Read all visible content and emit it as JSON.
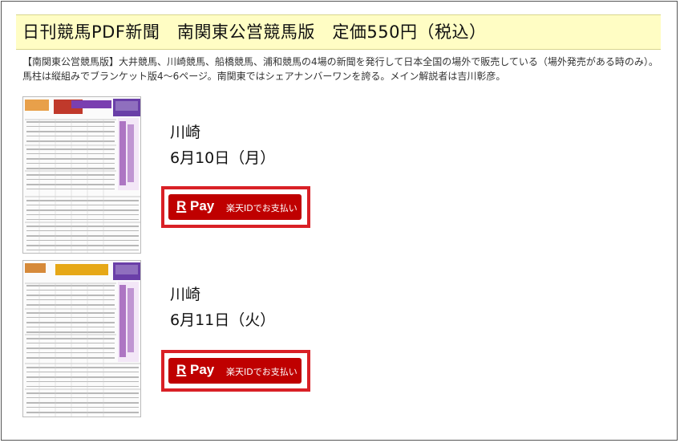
{
  "header": {
    "title": "日刊競馬PDF新聞　南関東公営競馬版　定価550円（税込）"
  },
  "description": "【南関東公営競馬版】大井競馬、川崎競馬、船橋競馬、浦和競馬の4場の新聞を発行して日本全国の場外で販売している（場外発売がある時のみ）。馬柱は縦組みでブランケット版4～6ページ。南関東ではシェアナンバーワンを誇る。メイン解説者は吉川彰彦。",
  "items": [
    {
      "venue": "川崎",
      "date": "6月10日（月）",
      "pay": {
        "logo_r": "R",
        "logo_pay": "Pay",
        "label": "楽天IDでお支払い"
      }
    },
    {
      "venue": "川崎",
      "date": "6月11日（火）",
      "pay": {
        "logo_r": "R",
        "logo_pay": "Pay",
        "label": "楽天IDでお支払い"
      }
    }
  ],
  "colors": {
    "title_background": "#fffdc4",
    "pay_button": "#bf0000",
    "pay_frame": "#d92026"
  }
}
